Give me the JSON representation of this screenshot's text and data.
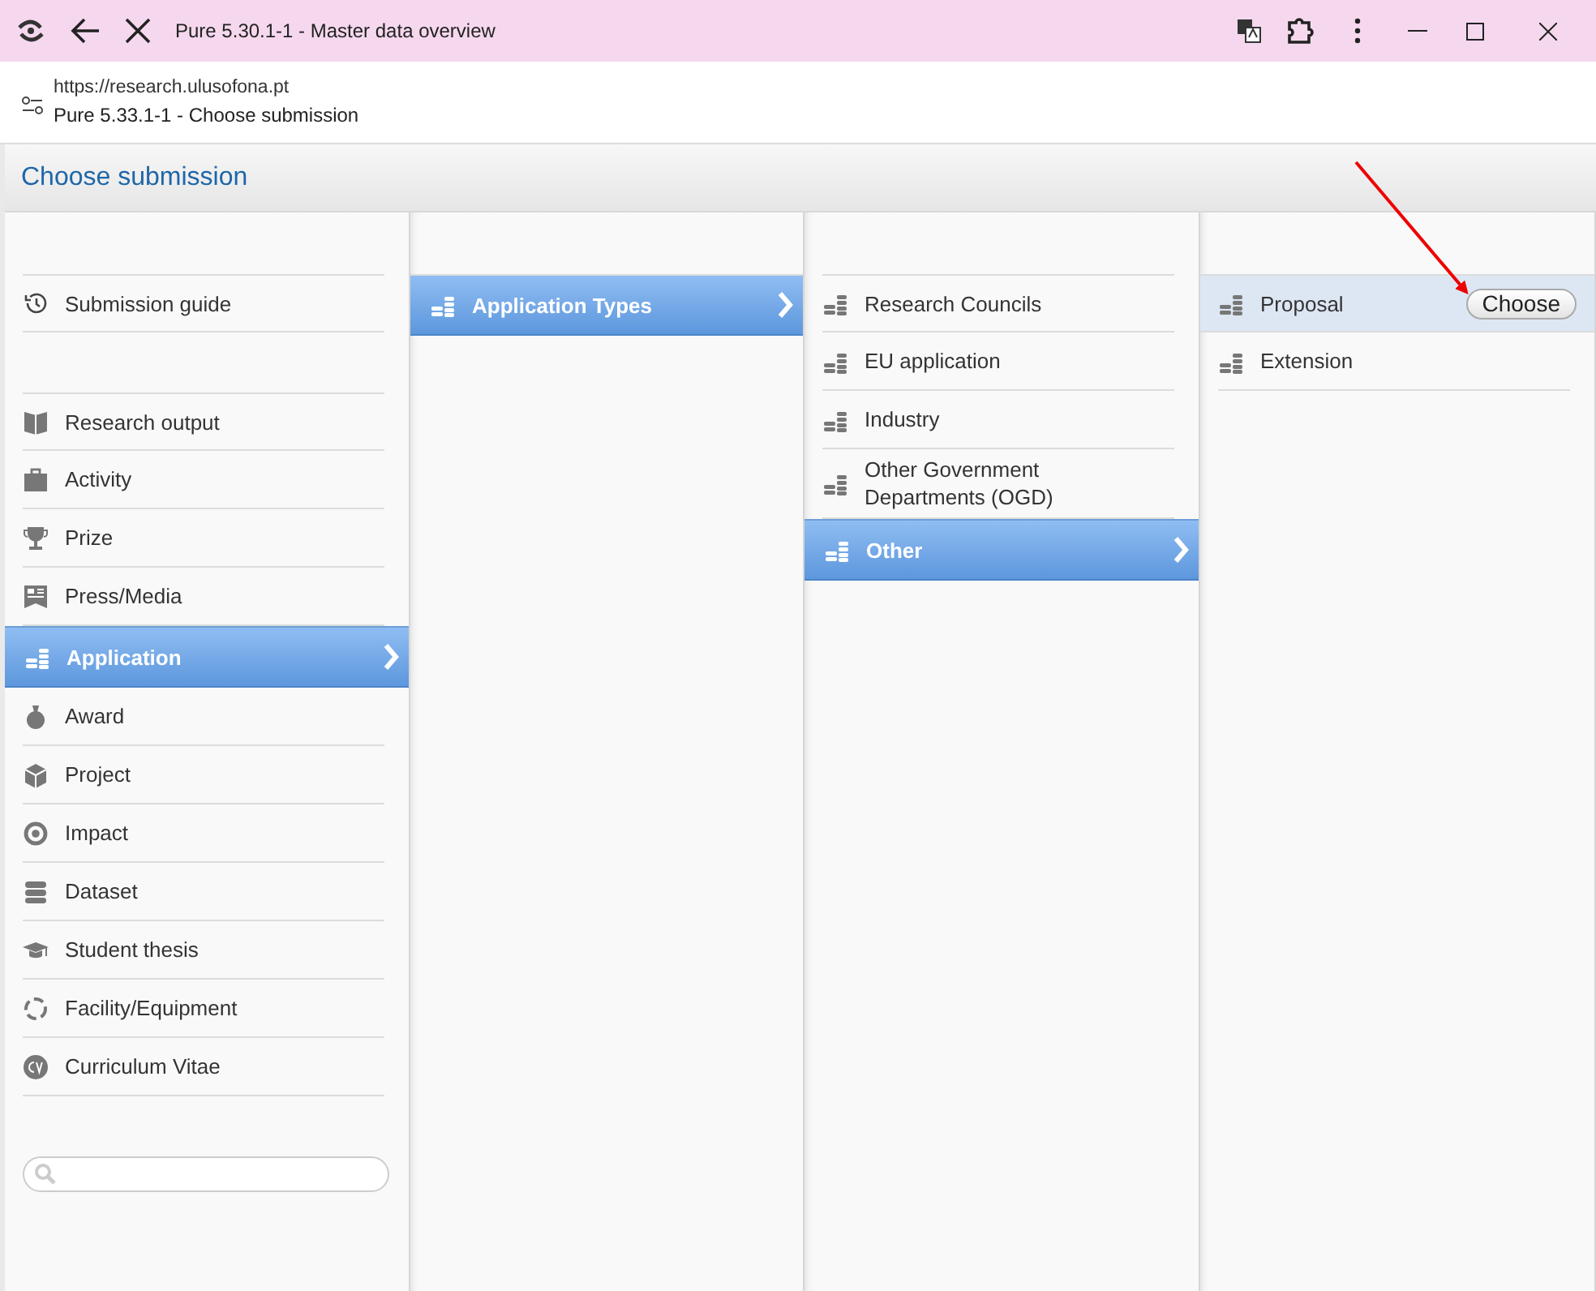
{
  "browser": {
    "title": "Pure 5.30.1-1 - Master data overview",
    "url": "https://research.ulusofona.pt",
    "page_title": "Pure 5.33.1-1 - Choose submission"
  },
  "dialog": {
    "title": "Choose submission"
  },
  "columns": [
    {
      "sections": [
        [
          {
            "label": "Submission guide",
            "selected": false
          }
        ],
        [
          {
            "label": "Research output",
            "selected": false
          },
          {
            "label": "Activity",
            "selected": false
          },
          {
            "label": "Prize",
            "selected": false
          },
          {
            "label": "Press/Media",
            "selected": false
          },
          {
            "label": "Application",
            "selected": true
          },
          {
            "label": "Award",
            "selected": false
          },
          {
            "label": "Project",
            "selected": false
          },
          {
            "label": "Impact",
            "selected": false
          },
          {
            "label": "Dataset",
            "selected": false
          },
          {
            "label": "Student thesis",
            "selected": false
          },
          {
            "label": "Facility/Equipment",
            "selected": false
          },
          {
            "label": "Curriculum Vitae",
            "selected": false
          }
        ]
      ],
      "has_search": true
    },
    {
      "sections": [
        [
          {
            "label": "Application Types",
            "selected": true
          }
        ]
      ]
    },
    {
      "sections": [
        [
          {
            "label": "Research Councils",
            "selected": false
          },
          {
            "label": "EU application",
            "selected": false
          },
          {
            "label": "Industry",
            "selected": false
          },
          {
            "label": "Other Government Departments (OGD)",
            "selected": false
          },
          {
            "label": "Other",
            "selected": true
          }
        ]
      ]
    },
    {
      "sections": [
        [
          {
            "label": "Proposal",
            "selected": false,
            "hovered": true,
            "button": "Choose"
          },
          {
            "label": "Extension",
            "selected": false,
            "hovered": false
          }
        ]
      ]
    }
  ]
}
